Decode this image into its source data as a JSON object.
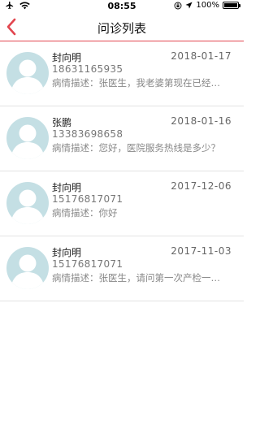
{
  "status_bar": {
    "time": "08:55",
    "battery_text": "100%",
    "battery_level": 1.0,
    "icons": [
      "airplane-icon",
      "wifi-icon",
      "orientation-lock-icon",
      "location-arrow-icon",
      "battery-icon"
    ]
  },
  "nav": {
    "title": "问诊列表",
    "back_icon": "chevron-left-icon",
    "accent_color": "#e2464f"
  },
  "items": [
    {
      "name": "封向明",
      "date": "2018-01-17",
      "phone": "18631165935",
      "desc": "病情描述：张医生，我老婆第现在已经…"
    },
    {
      "name": "张鹏",
      "date": "2018-01-16",
      "phone": "13383698658",
      "desc": "病情描述：您好，医院服务热线是多少？"
    },
    {
      "name": "封向明",
      "date": "2017-12-06",
      "phone": "15176817071",
      "desc": "病情描述：你好"
    },
    {
      "name": "封向明",
      "date": "2017-11-03",
      "phone": "15176817071",
      "desc": "病情描述：张医生，请问第一次产检一…"
    }
  ],
  "avatar_color": "#c4dfe4"
}
